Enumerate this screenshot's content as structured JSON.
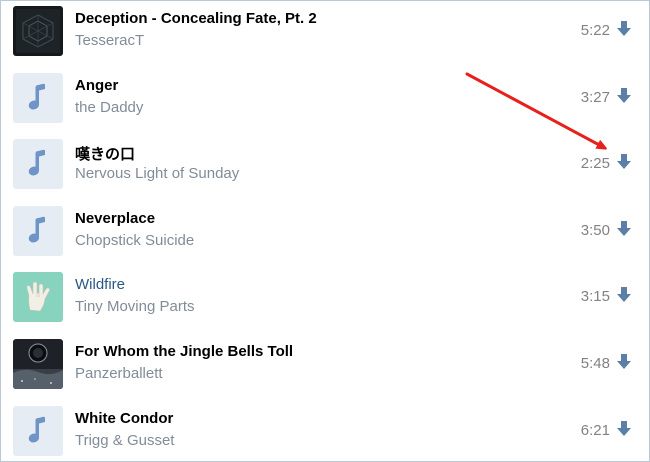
{
  "colors": {
    "title": "#000000",
    "title_link": "#2a5885",
    "artist": "#818c99",
    "duration": "#828282",
    "download_icon": "#5b7fa6",
    "note_icon": "#6f95c8",
    "note_bg": "#e6ecf3",
    "annotation_arrow": "#e8201b"
  },
  "tracks": [
    {
      "title": "Deception - Concealing Fate, Pt. 2",
      "artist": "TesseracT",
      "duration": "5:22",
      "cover": "album-art-dark-geometric",
      "title_style": "bold"
    },
    {
      "title": "Anger",
      "artist": "the Daddy",
      "duration": "3:27",
      "cover": "music-note-icon",
      "title_style": "bold"
    },
    {
      "title": "嘆きの口",
      "artist": "Nervous Light of Sunday",
      "duration": "2:25",
      "cover": "music-note-icon",
      "title_style": "bold"
    },
    {
      "title": "Neverplace",
      "artist": "Chopstick Suicide",
      "duration": "3:50",
      "cover": "music-note-icon",
      "title_style": "bold"
    },
    {
      "title": "Wildfire",
      "artist": "Tiny Moving Parts",
      "duration": "3:15",
      "cover": "album-art-hand-sign",
      "title_style": "link"
    },
    {
      "title": "For Whom the Jingle Bells Toll",
      "artist": "Panzerballett",
      "duration": "5:48",
      "cover": "album-art-dark-space",
      "title_style": "bold"
    },
    {
      "title": "White Condor",
      "artist": "Trigg & Gusset",
      "duration": "6:21",
      "cover": "music-note-icon",
      "title_style": "bold"
    }
  ],
  "icons": {
    "download": "download-arrow-icon",
    "annotation": "red-pointer-arrow"
  }
}
